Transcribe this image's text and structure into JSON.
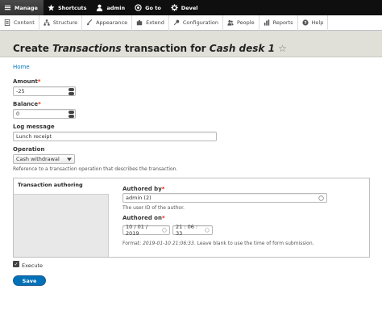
{
  "toolbar": {
    "items": [
      {
        "label": "Manage",
        "icon": "menu-icon"
      },
      {
        "label": "Shortcuts",
        "icon": "star-icon"
      },
      {
        "label": "admin",
        "icon": "user-icon"
      },
      {
        "label": "Go to",
        "icon": "goto-icon"
      },
      {
        "label": "Devel",
        "icon": "gear-icon"
      }
    ]
  },
  "tray": {
    "items": [
      {
        "label": "Content"
      },
      {
        "label": "Structure"
      },
      {
        "label": "Appearance"
      },
      {
        "label": "Extend"
      },
      {
        "label": "Configuration"
      },
      {
        "label": "People"
      },
      {
        "label": "Reports"
      },
      {
        "label": "Help"
      }
    ]
  },
  "page": {
    "title_prefix": "Create ",
    "title_entity": "Transactions",
    "title_middle": " transaction for ",
    "title_target": "Cash desk 1",
    "star": "☆",
    "breadcrumb": "Home"
  },
  "form": {
    "amount_label": "Amount",
    "amount_value": "-25",
    "balance_label": "Balance",
    "balance_value": "0",
    "log_label": "Log message",
    "log_value": "Lunch receipt",
    "operation_label": "Operation",
    "operation_value": "Cash withdrawal",
    "operation_desc": "Reference to a transaction operation that describes the transaction.",
    "authoring_tab": "Transaction authoring",
    "authored_by_label": "Authored by",
    "authored_by_value": "admin (2)",
    "authored_by_desc": "The user ID of the author.",
    "authored_on_label": "Authored on",
    "date_value": "10 / 01 / 2019",
    "time_value": "21 : 06 : 33",
    "format_prefix": "Format: ",
    "format_example": "2019-01-10 21:06:33",
    "format_suffix": ". Leave blank to use the time of form submission.",
    "execute_label": "Execute",
    "save_label": "Save",
    "required_mark": "*"
  }
}
